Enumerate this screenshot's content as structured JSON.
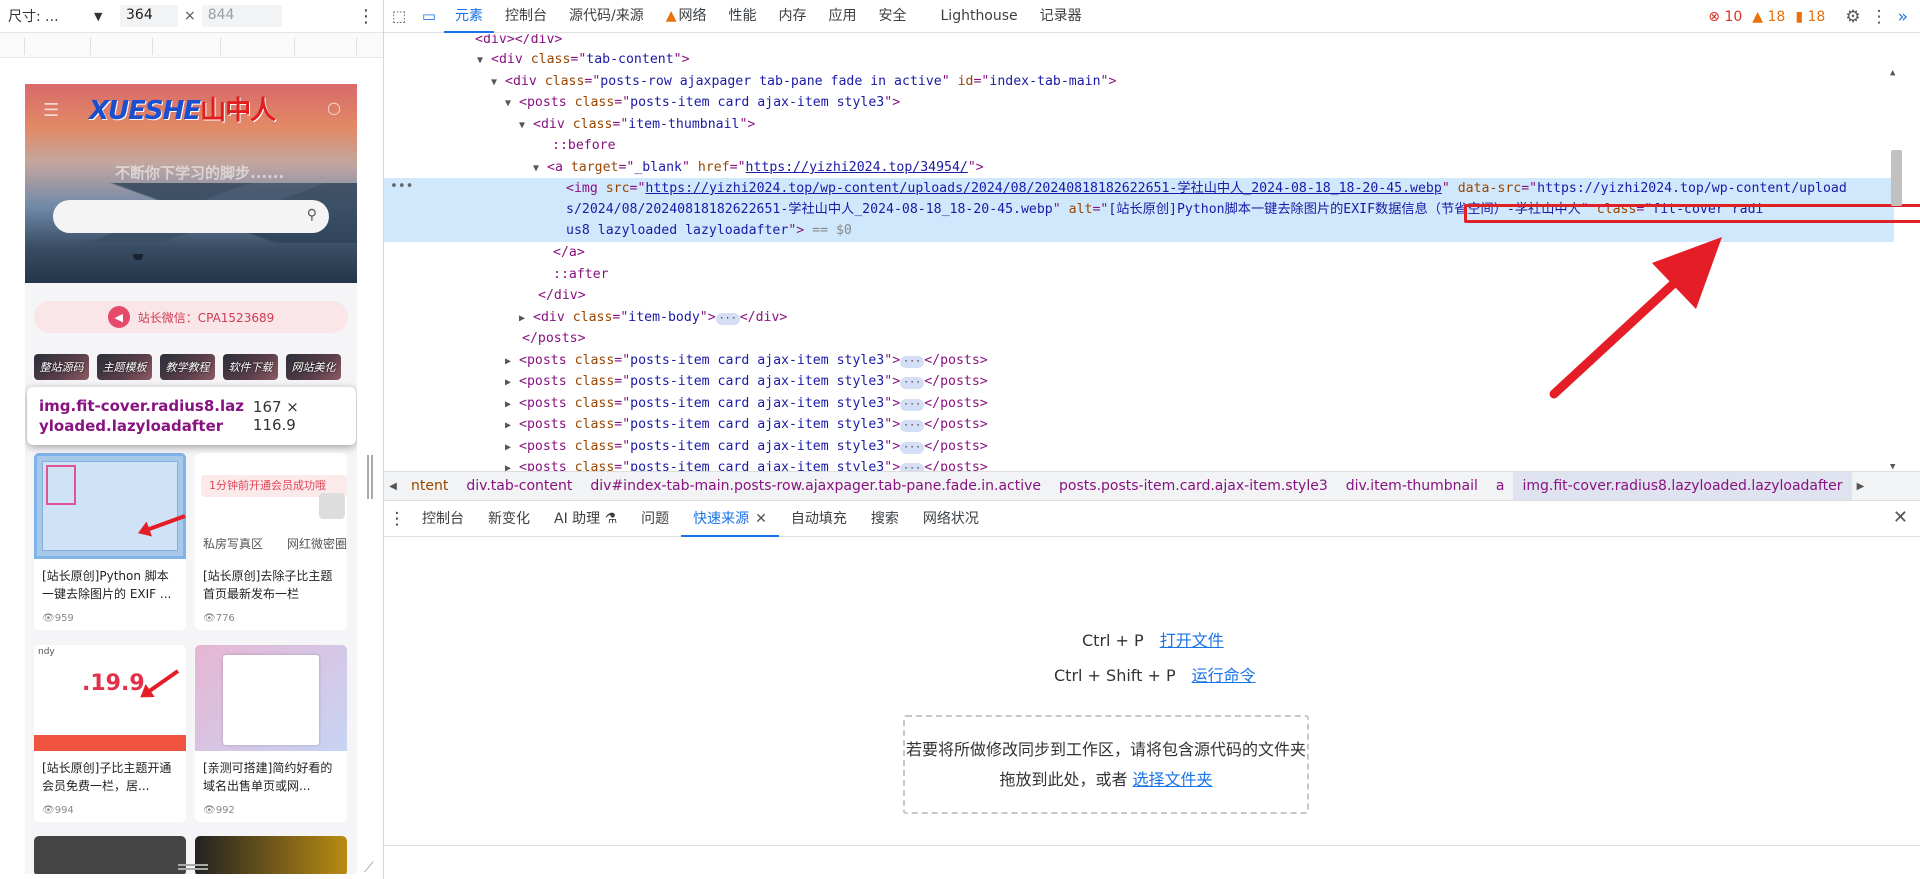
{
  "device_toolbar": {
    "dimensions_label": "尺寸: ...",
    "width_value": "364",
    "height_placeholder": "844",
    "times": "×"
  },
  "site": {
    "logo_text": "XUESHE",
    "logo_cn": "山中人",
    "slogan": "不断你下学习的脚步......",
    "wechat_label": "站长微信：CPA1523689",
    "categories": [
      "整站源码",
      "主题模板",
      "教学教程",
      "软件下载",
      "网站美化"
    ],
    "cards": [
      {
        "title": "[站长原创]Python 脚本一键去除图片的 EXIF ...",
        "views": "959"
      },
      {
        "title": "[站长原创]去除子比主题首页最新发布一栏",
        "views": "776",
        "thumb_pill": "1分钟前开通会员成功哦",
        "thumb_label1": "私房写真区",
        "thumb_label2": "网红微密圈"
      },
      {
        "title": "[站长原创]子比主题开通会员免费一栏，居...",
        "views": "994",
        "thumb_price": ".19.9",
        "thumb_tag": "ndy"
      },
      {
        "title": "[亲测可搭建]简约好看的域名出售单页或网...",
        "views": "992"
      }
    ]
  },
  "tooltip": {
    "selector": "img.fit-cover.radius8.lazyloaded.lazyloadafter",
    "size": "167 × 116.9"
  },
  "devtools": {
    "tabs": [
      "元素",
      "控制台",
      "源代码/来源",
      "网络",
      "性能",
      "内存",
      "应用",
      "安全",
      "Lighthouse",
      "记录器"
    ],
    "active_tab": "元素",
    "errors": "10",
    "warnings": "18",
    "issues": "18",
    "dom": {
      "l1": "</div>",
      "l2_cls": "tab-content",
      "l3_cls": "posts-row ajaxpager tab-pane fade in active",
      "l3_id": "index-tab-main",
      "l4_cls": "posts-item card ajax-item style3",
      "l5_cls": "item-thumbnail",
      "before": "::before",
      "a_target": "_blank",
      "a_href": "https://yizhi2024.top/34954/",
      "img_src": "https://yizhi2024.top/wp-content/uploads/2024/08/20240818182622651-学社山中人_2024-08-18_18-20-45.webp",
      "img_datasrc_a": "https://yizhi2024.top/wp-content/upload",
      "img_datasrc_b": "s/2024/08/20240818182622651-学社山中人_2024-08-18_18-20-45.webp",
      "img_alt": "[站长原创]Python脚本一键去除图片的EXIF数据信息（节省空间）-学社山中人",
      "img_class_a": "fit-cover radi",
      "img_class_b": "us8 lazyloaded lazyloadafter",
      "eq0": "== $0",
      "after": "::after",
      "body_cls": "item-body",
      "posts_close": "</posts>",
      "sibling_cls": "posts-item card ajax-item style3"
    },
    "breadcrumbs": [
      "ntent",
      "div.tab-content",
      "div#index-tab-main.posts-row.ajaxpager.tab-pane.fade.in.active",
      "posts.posts-item.card.ajax-item.style3",
      "div.item-thumbnail",
      "a",
      "img.fit-cover.radius8.lazyloaded.lazyloadafter"
    ],
    "drawer_tabs": [
      "控制台",
      "新变化",
      "AI 助理 ⚗",
      "问题",
      "快速来源",
      "自动填充",
      "搜索",
      "网络状况"
    ],
    "drawer_active": "快速来源",
    "quick_source": {
      "shortcut1_keys": "Ctrl + P",
      "shortcut1_action": "打开文件",
      "shortcut2_keys": "Ctrl + Shift + P",
      "shortcut2_action": "运行命令",
      "drop_line1": "若要将所做修改同步到工作区，请将包含源代码的文件夹",
      "drop_line2": "拖放到此处，或者",
      "drop_link": "选择文件夹"
    }
  },
  "colors": {
    "accent": "#1a73e8",
    "highlight_red": "#e12128",
    "selected_row": "#cfe8fc"
  }
}
